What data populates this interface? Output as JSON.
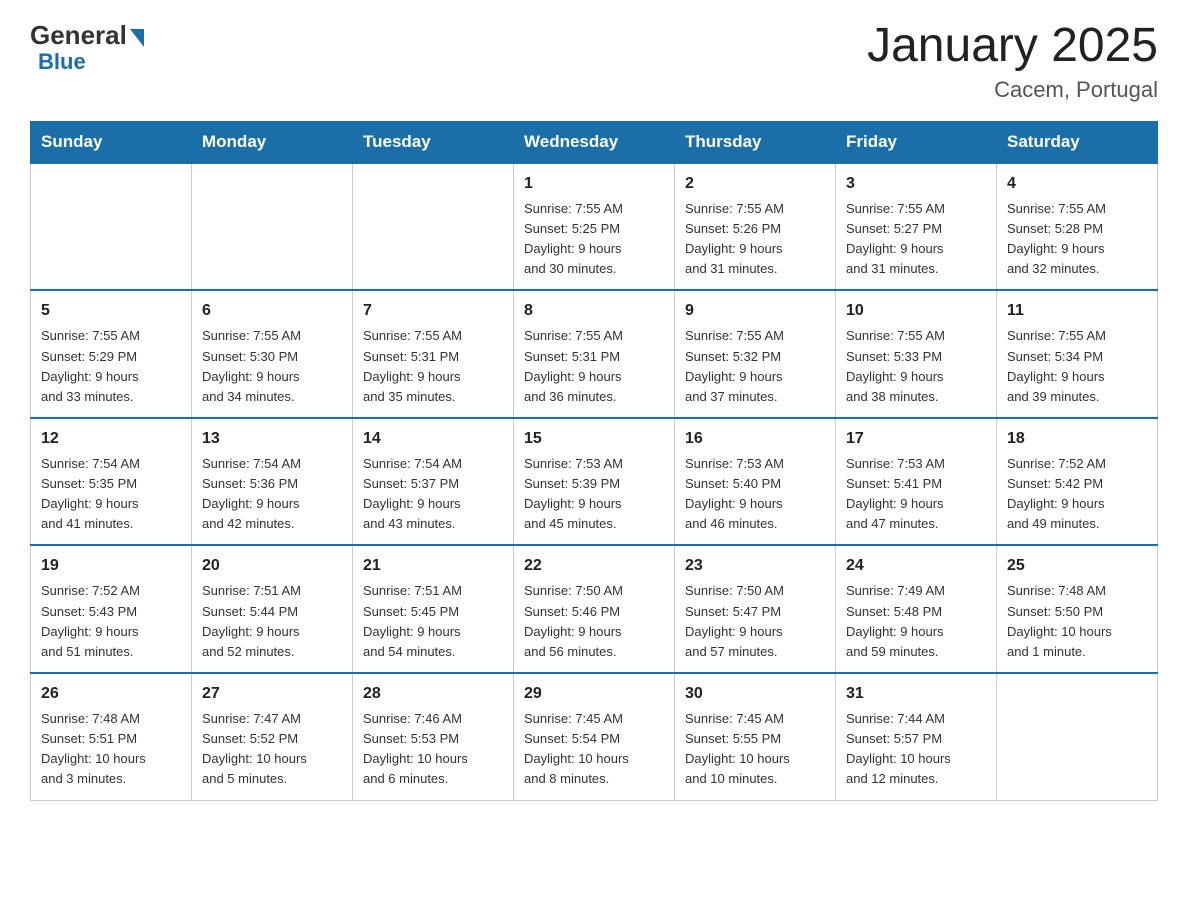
{
  "header": {
    "logo_general": "General",
    "logo_blue": "Blue",
    "title": "January 2025",
    "subtitle": "Cacem, Portugal"
  },
  "weekdays": [
    "Sunday",
    "Monday",
    "Tuesday",
    "Wednesday",
    "Thursday",
    "Friday",
    "Saturday"
  ],
  "weeks": [
    [
      {
        "day": "",
        "info": ""
      },
      {
        "day": "",
        "info": ""
      },
      {
        "day": "",
        "info": ""
      },
      {
        "day": "1",
        "info": "Sunrise: 7:55 AM\nSunset: 5:25 PM\nDaylight: 9 hours\nand 30 minutes."
      },
      {
        "day": "2",
        "info": "Sunrise: 7:55 AM\nSunset: 5:26 PM\nDaylight: 9 hours\nand 31 minutes."
      },
      {
        "day": "3",
        "info": "Sunrise: 7:55 AM\nSunset: 5:27 PM\nDaylight: 9 hours\nand 31 minutes."
      },
      {
        "day": "4",
        "info": "Sunrise: 7:55 AM\nSunset: 5:28 PM\nDaylight: 9 hours\nand 32 minutes."
      }
    ],
    [
      {
        "day": "5",
        "info": "Sunrise: 7:55 AM\nSunset: 5:29 PM\nDaylight: 9 hours\nand 33 minutes."
      },
      {
        "day": "6",
        "info": "Sunrise: 7:55 AM\nSunset: 5:30 PM\nDaylight: 9 hours\nand 34 minutes."
      },
      {
        "day": "7",
        "info": "Sunrise: 7:55 AM\nSunset: 5:31 PM\nDaylight: 9 hours\nand 35 minutes."
      },
      {
        "day": "8",
        "info": "Sunrise: 7:55 AM\nSunset: 5:31 PM\nDaylight: 9 hours\nand 36 minutes."
      },
      {
        "day": "9",
        "info": "Sunrise: 7:55 AM\nSunset: 5:32 PM\nDaylight: 9 hours\nand 37 minutes."
      },
      {
        "day": "10",
        "info": "Sunrise: 7:55 AM\nSunset: 5:33 PM\nDaylight: 9 hours\nand 38 minutes."
      },
      {
        "day": "11",
        "info": "Sunrise: 7:55 AM\nSunset: 5:34 PM\nDaylight: 9 hours\nand 39 minutes."
      }
    ],
    [
      {
        "day": "12",
        "info": "Sunrise: 7:54 AM\nSunset: 5:35 PM\nDaylight: 9 hours\nand 41 minutes."
      },
      {
        "day": "13",
        "info": "Sunrise: 7:54 AM\nSunset: 5:36 PM\nDaylight: 9 hours\nand 42 minutes."
      },
      {
        "day": "14",
        "info": "Sunrise: 7:54 AM\nSunset: 5:37 PM\nDaylight: 9 hours\nand 43 minutes."
      },
      {
        "day": "15",
        "info": "Sunrise: 7:53 AM\nSunset: 5:39 PM\nDaylight: 9 hours\nand 45 minutes."
      },
      {
        "day": "16",
        "info": "Sunrise: 7:53 AM\nSunset: 5:40 PM\nDaylight: 9 hours\nand 46 minutes."
      },
      {
        "day": "17",
        "info": "Sunrise: 7:53 AM\nSunset: 5:41 PM\nDaylight: 9 hours\nand 47 minutes."
      },
      {
        "day": "18",
        "info": "Sunrise: 7:52 AM\nSunset: 5:42 PM\nDaylight: 9 hours\nand 49 minutes."
      }
    ],
    [
      {
        "day": "19",
        "info": "Sunrise: 7:52 AM\nSunset: 5:43 PM\nDaylight: 9 hours\nand 51 minutes."
      },
      {
        "day": "20",
        "info": "Sunrise: 7:51 AM\nSunset: 5:44 PM\nDaylight: 9 hours\nand 52 minutes."
      },
      {
        "day": "21",
        "info": "Sunrise: 7:51 AM\nSunset: 5:45 PM\nDaylight: 9 hours\nand 54 minutes."
      },
      {
        "day": "22",
        "info": "Sunrise: 7:50 AM\nSunset: 5:46 PM\nDaylight: 9 hours\nand 56 minutes."
      },
      {
        "day": "23",
        "info": "Sunrise: 7:50 AM\nSunset: 5:47 PM\nDaylight: 9 hours\nand 57 minutes."
      },
      {
        "day": "24",
        "info": "Sunrise: 7:49 AM\nSunset: 5:48 PM\nDaylight: 9 hours\nand 59 minutes."
      },
      {
        "day": "25",
        "info": "Sunrise: 7:48 AM\nSunset: 5:50 PM\nDaylight: 10 hours\nand 1 minute."
      }
    ],
    [
      {
        "day": "26",
        "info": "Sunrise: 7:48 AM\nSunset: 5:51 PM\nDaylight: 10 hours\nand 3 minutes."
      },
      {
        "day": "27",
        "info": "Sunrise: 7:47 AM\nSunset: 5:52 PM\nDaylight: 10 hours\nand 5 minutes."
      },
      {
        "day": "28",
        "info": "Sunrise: 7:46 AM\nSunset: 5:53 PM\nDaylight: 10 hours\nand 6 minutes."
      },
      {
        "day": "29",
        "info": "Sunrise: 7:45 AM\nSunset: 5:54 PM\nDaylight: 10 hours\nand 8 minutes."
      },
      {
        "day": "30",
        "info": "Sunrise: 7:45 AM\nSunset: 5:55 PM\nDaylight: 10 hours\nand 10 minutes."
      },
      {
        "day": "31",
        "info": "Sunrise: 7:44 AM\nSunset: 5:57 PM\nDaylight: 10 hours\nand 12 minutes."
      },
      {
        "day": "",
        "info": ""
      }
    ]
  ]
}
